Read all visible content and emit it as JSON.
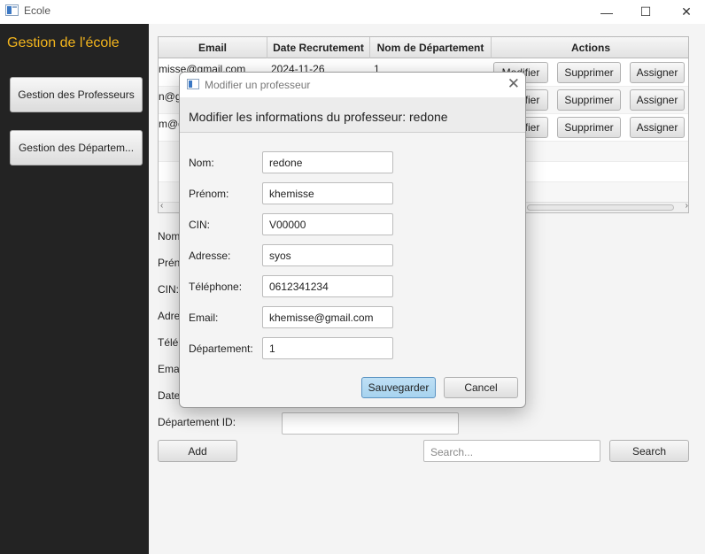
{
  "window": {
    "title": "Ecole",
    "minimize_glyph": "—",
    "maximize_glyph": "☐",
    "close_glyph": "✕"
  },
  "sidebar": {
    "brand": "Gestion de l'école",
    "items": [
      {
        "label": "Gestion des Professeurs"
      },
      {
        "label": "Gestion des Départem..."
      }
    ]
  },
  "table": {
    "columns": [
      "Email",
      "Date Recrutement",
      "Nom de Département",
      "Actions"
    ],
    "rows": [
      {
        "email": "misse@gmail.com",
        "date": "2024-11-26",
        "dept": "1"
      },
      {
        "email": "n@gmail.com",
        "date": "",
        "dept": ""
      },
      {
        "email": "m@gmail.com",
        "date": "",
        "dept": ""
      }
    ],
    "actions": {
      "modify": "Modifier",
      "delete": "Supprimer",
      "assign": "Assigner"
    }
  },
  "form": {
    "labels": [
      "Nom:",
      "Prénom:",
      "CIN:",
      "Adresse:",
      "Téléphone:",
      "Email:",
      "Date Recrutement:",
      "Département ID:"
    ],
    "add_label": "Add",
    "search_placeholder": "Search...",
    "search_label": "Search"
  },
  "dialog": {
    "title": "Modifier un professeur",
    "close_glyph": "✕",
    "header": "Modifier les informations du professeur: redone",
    "fields": [
      {
        "label": "Nom:",
        "value": "redone"
      },
      {
        "label": "Prénom:",
        "value": "khemisse"
      },
      {
        "label": "CIN:",
        "value": "V00000"
      },
      {
        "label": "Adresse:",
        "value": "syos"
      },
      {
        "label": "Téléphone:",
        "value": "0612341234"
      },
      {
        "label": "Email:",
        "value": "khemisse@gmail.com"
      },
      {
        "label": "Département:",
        "value": "1"
      }
    ],
    "save_label": "Sauvegarder",
    "cancel_label": "Cancel"
  },
  "colors": {
    "brand": "#f3b51d",
    "sidebar_bg": "#232323",
    "primary_button": "#a7d3ef"
  }
}
